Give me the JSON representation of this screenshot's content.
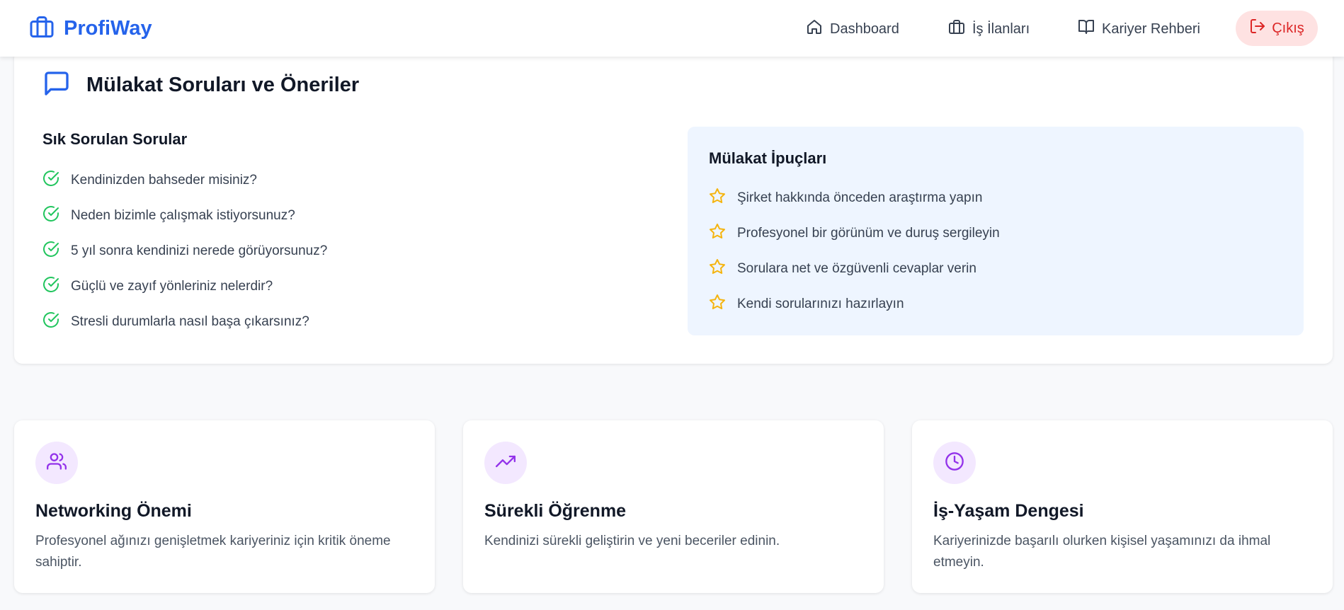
{
  "navbar": {
    "brand": "ProfiWay",
    "items": [
      {
        "label": "Dashboard",
        "icon": "home-icon"
      },
      {
        "label": "İş İlanları",
        "icon": "briefcase-icon"
      },
      {
        "label": "Kariyer Rehberi",
        "icon": "book-open-icon"
      }
    ],
    "logout_label": "Çıkış",
    "logout_icon": "logout-icon"
  },
  "interview": {
    "title": "Mülakat Soruları ve Öneriler",
    "title_icon": "message-square-icon",
    "faq_heading": "Sık Sorulan Sorular",
    "faq": [
      "Kendinizden bahseder misiniz?",
      "Neden bizimle çalışmak istiyorsunuz?",
      "5 yıl sonra kendinizi nerede görüyorsunuz?",
      "Güçlü ve zayıf yönleriniz nelerdir?",
      "Stresli durumlarla nasıl başa çıkarsınız?"
    ],
    "tips_heading": "Mülakat İpuçları",
    "tips": [
      "Şirket hakkında önceden araştırma yapın",
      "Profesyonel bir görünüm ve duruş sergileyin",
      "Sorulara net ve özgüvenli cevaplar verin",
      "Kendi sorularınızı hazırlayın"
    ]
  },
  "features": [
    {
      "title": "Networking Önemi",
      "desc": "Profesyonel ağınızı genişletmek kariyeriniz için kritik öneme sahiptir.",
      "icon": "users-icon"
    },
    {
      "title": "Sürekli Öğrenme",
      "desc": "Kendinizi sürekli geliştirin ve yeni beceriler edinin.",
      "icon": "trending-up-icon"
    },
    {
      "title": "İş-Yaşam Dengesi",
      "desc": "Kariyerinizde başarılı olurken kişisel yaşamınızı da ihmal etmeyin.",
      "icon": "clock-icon"
    }
  ],
  "colors": {
    "brand": "#2563eb",
    "logout_bg": "#fee2e2",
    "logout_text": "#dc2626",
    "check": "#22c55e",
    "star": "#f5b40f",
    "tips_bg": "#eef5ff",
    "feature_icon_bg": "#f3e8ff",
    "feature_icon": "#9333ea"
  }
}
